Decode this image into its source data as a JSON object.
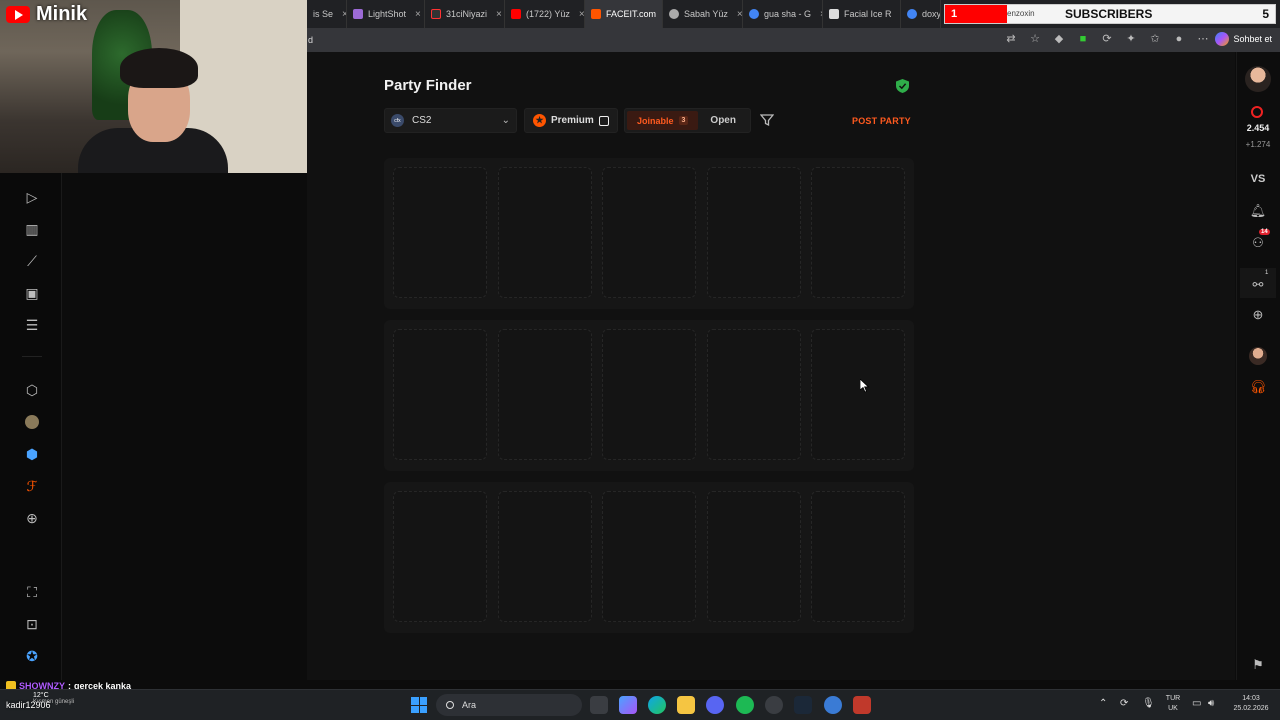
{
  "browser": {
    "tabs": [
      {
        "label": "is Se",
        "color": "#8ab4f8"
      },
      {
        "label": "LightShot",
        "color": "#9c6ad6"
      },
      {
        "label": "31ciNiyazi",
        "color": "#ff0000"
      },
      {
        "label": "(1722) Yüz",
        "color": "#ff0000"
      },
      {
        "label": "FACEIT.com",
        "color": "#ff5500"
      },
      {
        "label": "Sabah Yüz",
        "color": "#aaaaaa"
      },
      {
        "label": "gua sha - G",
        "color": "#4285f4"
      },
      {
        "label": "Facial Ice R",
        "color": "#dddddd"
      },
      {
        "label": "doxyc",
        "color": "#4285f4"
      }
    ],
    "active_tab_index": 4,
    "address": "d",
    "chat_button": "Sohbet et"
  },
  "overlay": {
    "channel_name": "Minik",
    "subscribers": {
      "label": "SUBSCRIBERS",
      "current": "1",
      "goal": "5",
      "partial_tab_text": "enzoxin",
      "fill_color": "#ff0000"
    }
  },
  "faceit": {
    "page_title": "Party Finder",
    "game_selector": {
      "badge": "cfx",
      "value": "CS2"
    },
    "premium_label": "Premium",
    "joinable_label": "Joinable",
    "joinable_count": "3",
    "open_label": "Open",
    "post_party_label": "POST PARTY",
    "accent_color": "#ff5a1f",
    "party_rows": 3,
    "slots_per_row": 5
  },
  "right_rail": {
    "elo": "2.454",
    "elo_delta": "+1.274",
    "vs_label": "VS",
    "friends_badge": "14",
    "party_badge": "1"
  },
  "chat": {
    "line1_user": "SHOWNZY",
    "line1_text": "gerçek kanka",
    "line2_text": "kadir12906"
  },
  "weather": {
    "temp": "12°C",
    "condition": "Kısmen güneşli"
  },
  "taskbar": {
    "search_placeholder": "Ara",
    "language": "TUR",
    "layout": "UK",
    "time": "14:03",
    "date": "25.02.2026"
  }
}
